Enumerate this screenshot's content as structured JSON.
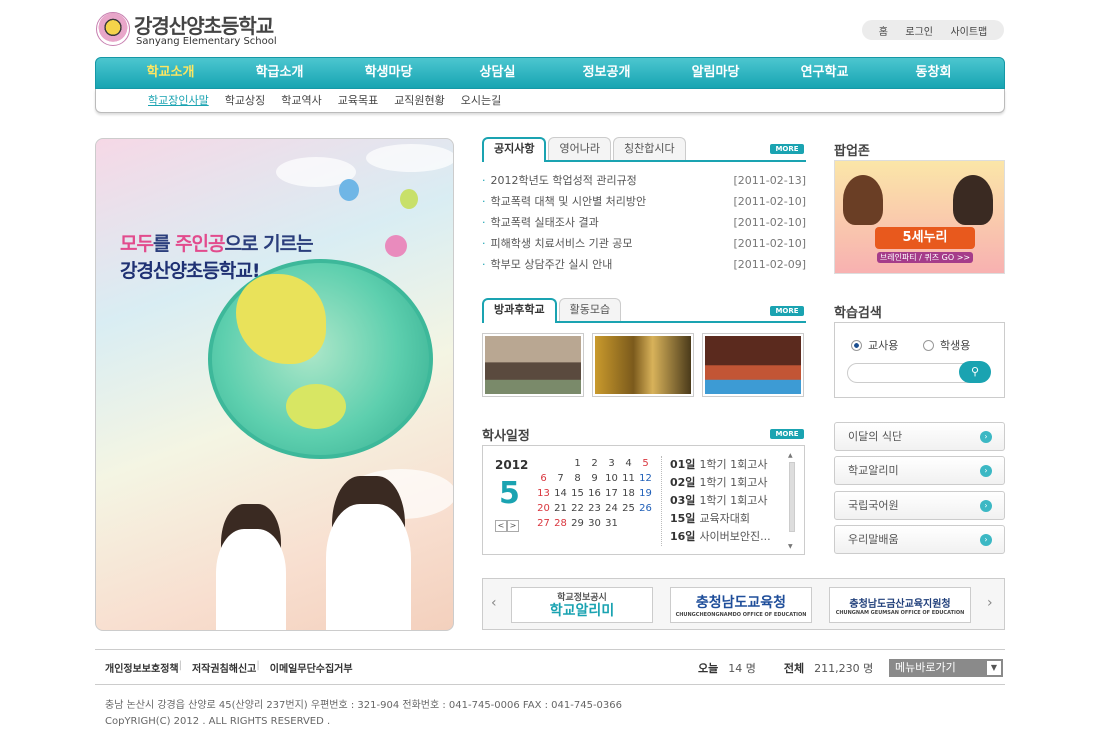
{
  "header": {
    "school_name_ko": "강경산양초등학교",
    "school_name_en": "Sanyang Elementary School",
    "util_links": [
      "홈",
      "로그인",
      "사이트맵"
    ]
  },
  "gnb": [
    "학교소개",
    "학급소개",
    "학생마당",
    "상담실",
    "정보공개",
    "알림마당",
    "연구학교",
    "동창회"
  ],
  "lnb": [
    "학교장인사말",
    "학교상징",
    "학교역사",
    "교육목표",
    "교직원현황",
    "오시는길"
  ],
  "visual": {
    "slogan_line1_a": "모두",
    "slogan_line1_b": "를 ",
    "slogan_line1_c": "주인공",
    "slogan_line1_d": "으로 기르는",
    "slogan_line2": "강경산양초등학교!"
  },
  "notice": {
    "tabs": [
      "공지사항",
      "영어나라",
      "칭찬합시다"
    ],
    "more": "MORE",
    "items": [
      {
        "title": "2012학년도 학업성적 관리규정",
        "date": "[2011-02-13]"
      },
      {
        "title": "학교폭력 대책 및 시안별 처리방안",
        "date": "[2011-02-10]"
      },
      {
        "title": "학교폭력 실태조사 결과",
        "date": "[2011-02-10]"
      },
      {
        "title": "피해학생 치료서비스 기관 공모",
        "date": "[2011-02-10]"
      },
      {
        "title": "학부모 상담주간 실시 안내",
        "date": "[2011-02-09]"
      }
    ]
  },
  "gallery": {
    "tabs": [
      "방과후학교",
      "활동모습"
    ],
    "more": "MORE"
  },
  "schedule": {
    "title": "학사일정",
    "more": "MORE",
    "year": "2012",
    "month": "5",
    "weeks": [
      [
        "",
        "",
        "1",
        "2",
        "3",
        "4",
        "5"
      ],
      [
        "6",
        "7",
        "8",
        "9",
        "10",
        "11",
        "12"
      ],
      [
        "13",
        "14",
        "15",
        "16",
        "17",
        "18",
        "19"
      ],
      [
        "20",
        "21",
        "22",
        "23",
        "24",
        "25",
        "26"
      ],
      [
        "27",
        "28",
        "29",
        "30",
        "31",
        "",
        ""
      ]
    ],
    "events": [
      {
        "day": "01일",
        "text": "1학기 1회고사"
      },
      {
        "day": "02일",
        "text": "1학기 1회고사"
      },
      {
        "day": "03일",
        "text": "1학기 1회고사"
      },
      {
        "day": "15일",
        "text": "교육자대회"
      },
      {
        "day": "16일",
        "text": "사이버보안진..."
      }
    ]
  },
  "banners": [
    {
      "top": "학교정보공시",
      "main": "학교알리미",
      "color": "#1aa3b1"
    },
    {
      "top": "",
      "main": "충청남도교육청",
      "sub": "CHUNGCHEONGNAMDO OFFICE OF EDUCATION",
      "color": "#1f4e9a"
    },
    {
      "top": "",
      "main": "충청남도금산교육지원청",
      "sub": "CHUNGNAM GEUMSAN OFFICE OF EDUCATION",
      "color": "#1f3e7a"
    }
  ],
  "right": {
    "popup_title": "팝업존",
    "popup_badge": "5세누리",
    "popup_sub": "브레인파티 / 퀴즈 GO >>",
    "search_title": "학습검색",
    "radio_teacher": "교사용",
    "radio_student": "학생용",
    "quick_links": [
      "이달의 식단",
      "학교알리미",
      "국립국어원",
      "우리말배움"
    ]
  },
  "footer": {
    "policy": [
      "개인정보보호정책",
      "저작권침해신고",
      "이메일무단수집거부"
    ],
    "today_label": "오늘",
    "today_value": "14 명",
    "total_label": "전체",
    "total_value": "211,230 명",
    "menu_go": "메뉴바로가기",
    "address": "충남 논산시 강경읍 산양로 45(산양리 237번지) 우편번호 : 321-904   전화번호 : 041-745-0006   FAX : 041-745-0366",
    "copyright": "CopYRIGH(C) 2012 . ALL RIGHTS RESERVED ."
  },
  "colors": {
    "accent": "#1aa3b1",
    "sunday": "#d9363e",
    "saturday": "#1f5fb8"
  }
}
